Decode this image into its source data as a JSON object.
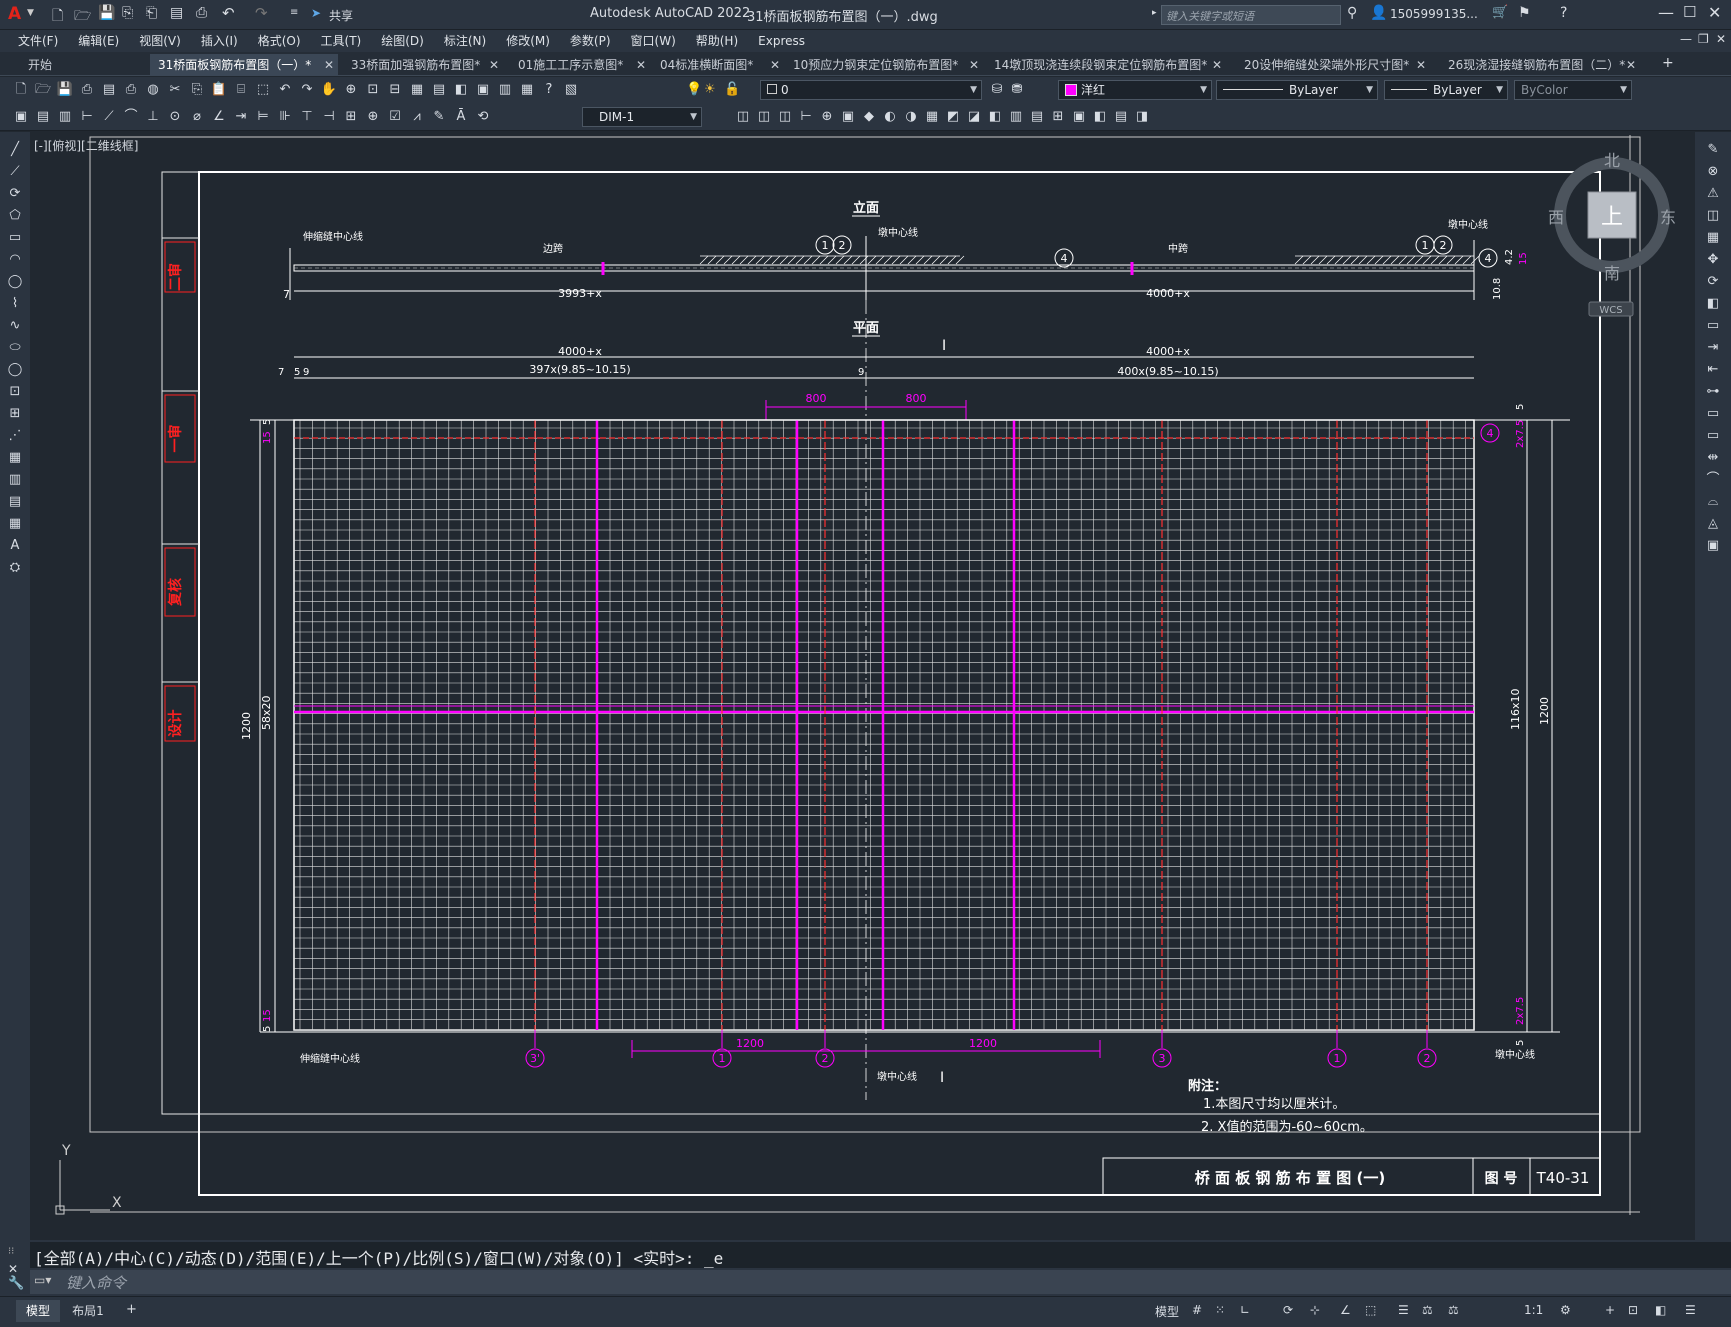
{
  "app": {
    "title": "Autodesk AutoCAD 2022",
    "file": "31桥面板钢筋布置图（一）.dwg",
    "share": "共享",
    "search_placeholder": "键入关键字或短语",
    "user": "1505999135...",
    "logo": "A"
  },
  "menu": [
    "文件(F)",
    "编辑(E)",
    "视图(V)",
    "插入(I)",
    "格式(O)",
    "工具(T)",
    "绘图(D)",
    "标注(N)",
    "修改(M)",
    "参数(P)",
    "窗口(W)",
    "帮助(H)",
    "Express"
  ],
  "tabs": [
    {
      "label": "开始"
    },
    {
      "label": "31桥面板钢筋布置图（一）*",
      "active": true
    },
    {
      "label": "33桥面加强钢筋布置图*"
    },
    {
      "label": "01施工工序示意图*"
    },
    {
      "label": "04标准横断面图*"
    },
    {
      "label": "10预应力钢束定位钢筋布置图*"
    },
    {
      "label": "14墩顶现浇连续段钢束定位钢筋布置图*"
    },
    {
      "label": "20设伸缩缝处梁端外形尺寸图*"
    },
    {
      "label": "26现浇湿接缝钢筋布置图（二）*"
    }
  ],
  "toolbar": {
    "layer_value": "0",
    "color_value": "洋红",
    "linetype_value": "ByLayer",
    "lineweight_value": "ByLayer",
    "plotstyle_value": "ByColor",
    "dimstyle_value": "DIM-1"
  },
  "viewport": {
    "label": "[-][俯视][二维线框]"
  },
  "viewcube": {
    "north": "北",
    "south": "南",
    "east": "东",
    "west": "西",
    "top": "上",
    "wcs": "WCS"
  },
  "ucs": {
    "y": "Y",
    "x": "X"
  },
  "drawing": {
    "elevation_title": "立面",
    "plan_title": "平面",
    "seam_center": "伸缩缝中心线",
    "pier_center": "墩中心线",
    "road_left": "边跨",
    "road_right": "中跨",
    "dims_elev": {
      "left_small": "7",
      "left_span": "3993+x",
      "right_span": "4000+x",
      "right_v1": "10.8",
      "right_v2": "4.2",
      "right_v3": "15"
    },
    "dims_plan": {
      "span_left": "4000+x",
      "span_right": "4000+x",
      "div_left": "397x(9.85~10.15)",
      "div_right": "400x(9.85~10.15)",
      "a7": "7",
      "a5": "5",
      "a9": "9",
      "mid9": "9",
      "d800a": "800",
      "d800b": "800",
      "h1200": "1200",
      "h58": "58x20",
      "h15a": "15",
      "h15b": "15",
      "h5a": "5",
      "h5b": "5",
      "r1200": "1200",
      "r116": "116x10",
      "r5a": "5",
      "r5b": "5",
      "r27a": "2x7.5",
      "r27b": "2x7.5",
      "b1200a": "1200",
      "b1200b": "1200"
    },
    "circles": {
      "c1": "1",
      "c2": "2",
      "c3": "3",
      "c3p": "3'",
      "c4": "4"
    },
    "side_labels": [
      "二审",
      "一审",
      "复核",
      "设计"
    ],
    "notes_title": "附注：",
    "notes": [
      "1.本图尺寸均以厘米计。",
      "2. X值的范围为-60~60cm。"
    ],
    "title_block": {
      "title": "桥 面 板 钢 筋 布 置 图 (一)",
      "label": "图 号",
      "code": "T40-31"
    }
  },
  "command": {
    "history": "[全部(A)/中心(C)/动态(D)/范围(E)/上一个(P)/比例(S)/窗口(W)/对象(O)] <实时>: _e",
    "placeholder": "键入命令"
  },
  "status": {
    "model_tab": "模型",
    "layout_tab": "布局1",
    "add": "+",
    "model_btn": "模型",
    "scale": "1:1"
  }
}
